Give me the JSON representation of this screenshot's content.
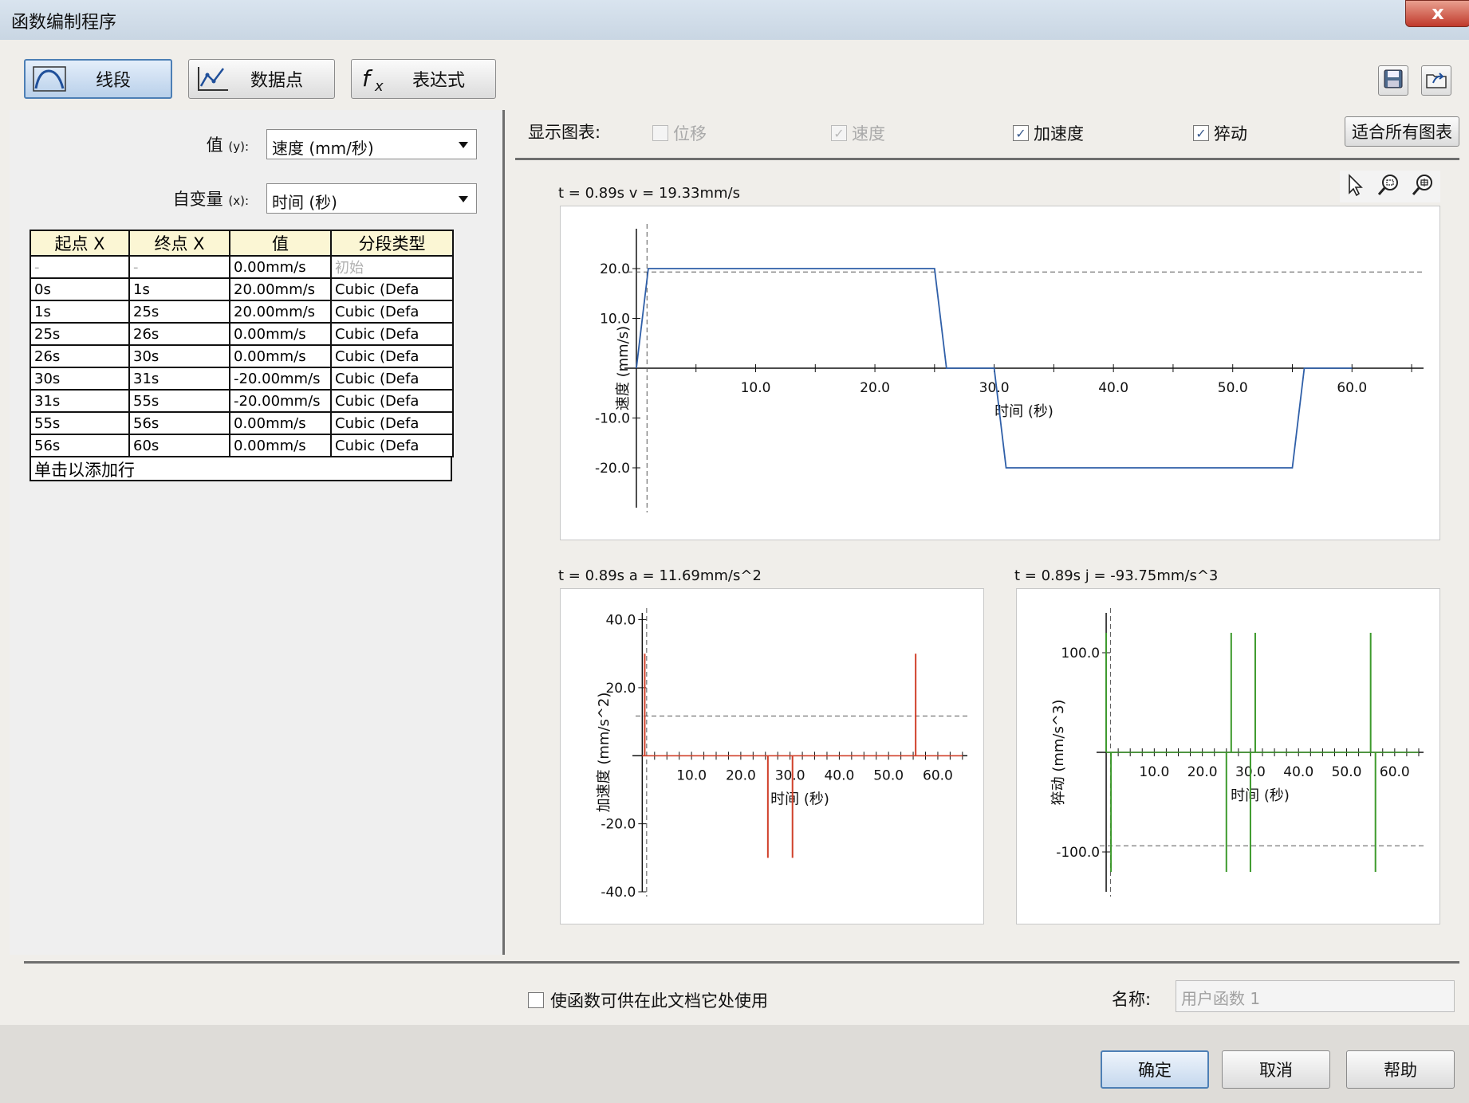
{
  "window": {
    "title": "函数编制程序",
    "close_label": "x"
  },
  "toolbar": {
    "modes": [
      {
        "label": "线段",
        "icon": "segment-curve-icon",
        "active": true
      },
      {
        "label": "数据点",
        "icon": "data-points-chart-icon",
        "active": false
      },
      {
        "label": "表达式",
        "icon": "fx-expression-icon",
        "active": false
      }
    ],
    "save_icon": "save-disk-icon",
    "import_icon": "open-folder-icon"
  },
  "form": {
    "value_label": "值",
    "value_hint": "(y):",
    "value_selected": "速度 (mm/秒)",
    "variable_label": "自变量",
    "variable_hint": "(x):",
    "variable_selected": "时间 (秒)"
  },
  "segment_table": {
    "headers": [
      "起点 X",
      "终点 X",
      "值",
      "分段类型"
    ],
    "rows": [
      [
        "-",
        "-",
        "0.00mm/s",
        "初始"
      ],
      [
        "0s",
        "1s",
        "20.00mm/s",
        "Cubic (Defa"
      ],
      [
        "1s",
        "25s",
        "20.00mm/s",
        "Cubic (Defa"
      ],
      [
        "25s",
        "26s",
        "0.00mm/s",
        "Cubic (Defa"
      ],
      [
        "26s",
        "30s",
        "0.00mm/s",
        "Cubic (Defa"
      ],
      [
        "30s",
        "31s",
        "-20.00mm/s",
        "Cubic (Defa"
      ],
      [
        "31s",
        "55s",
        "-20.00mm/s",
        "Cubic (Defa"
      ],
      [
        "55s",
        "56s",
        "0.00mm/s",
        "Cubic (Defa"
      ],
      [
        "56s",
        "60s",
        "0.00mm/s",
        "Cubic (Defa"
      ]
    ],
    "add_row_label": "单击以添加行"
  },
  "display": {
    "label": "显示图表:",
    "options": [
      {
        "label": "位移",
        "checked": false,
        "enabled": false
      },
      {
        "label": "速度",
        "checked": true,
        "enabled": false
      },
      {
        "label": "加速度",
        "checked": true,
        "enabled": true
      },
      {
        "label": "猝动",
        "checked": true,
        "enabled": true
      }
    ],
    "fit_button": "适合所有图表"
  },
  "chart_tools": [
    "pointer-arrow-icon",
    "zoom-region-icon",
    "zoom-fit-icon"
  ],
  "chart_data": [
    {
      "type": "line",
      "readout": "t = 0.89s  v = 19.33mm/s",
      "xlabel": "时间 (秒)",
      "ylabel": "速度 (mm/s)",
      "xlim": [
        -1,
        66
      ],
      "ylim": [
        -28,
        28
      ],
      "xticks": [
        10.0,
        20.0,
        30.0,
        40.0,
        50.0,
        60.0
      ],
      "xtick_labels": [
        "10.0",
        "20.0",
        "30.0",
        "40.0",
        "50.0",
        "60.0"
      ],
      "yticks": [
        20.0,
        10.0,
        -10.0,
        -20.0
      ],
      "ytick_labels": [
        "20.0",
        "10.0",
        "-10.0",
        "-20.0"
      ],
      "color": "#2f5fa8",
      "cursor_x": 0.89,
      "cursor_y": 19.33,
      "series": [
        {
          "x": [
            0,
            1,
            25,
            26,
            30,
            31,
            55,
            56,
            60
          ],
          "y": [
            0,
            20,
            20,
            0,
            0,
            -20,
            -20,
            0,
            0
          ]
        }
      ]
    },
    {
      "type": "line",
      "readout": "t = 0.89s  a = 11.69mm/s^2",
      "xlabel": "时间 (秒)",
      "ylabel": "加速度 (mm/s^2)",
      "xlim": [
        -2,
        66
      ],
      "ylim": [
        -40,
        42
      ],
      "xticks": [
        10.0,
        20.0,
        30.0,
        40.0,
        50.0,
        60.0
      ],
      "xtick_labels": [
        "10.0",
        "20.0",
        "30.0",
        "40.0",
        "50.0",
        "60.0"
      ],
      "yticks": [
        40.0,
        20.0,
        -20.0,
        -40.0
      ],
      "ytick_labels": [
        "40.0",
        "20.0",
        "-20.0",
        "-40.0"
      ],
      "color": "#d0402a",
      "cursor_x": 0.89,
      "cursor_y": 11.69,
      "spikes": [
        {
          "x": 0.5,
          "y": 30
        },
        {
          "x": 25.5,
          "y": -30
        },
        {
          "x": 30.5,
          "y": -30
        },
        {
          "x": 55.5,
          "y": 30
        }
      ]
    },
    {
      "type": "line",
      "readout": "t = 0.89s  j = -93.75mm/s^3",
      "xlabel": "时间 (秒)",
      "ylabel": "猝动 (mm/s^3)",
      "xlim": [
        -2,
        66
      ],
      "ylim": [
        -140,
        140
      ],
      "xticks": [
        10.0,
        20.0,
        30.0,
        40.0,
        50.0,
        60.0
      ],
      "xtick_labels": [
        "10.0",
        "20.0",
        "30.0",
        "40.0",
        "50.0",
        "60.0"
      ],
      "yticks": [
        100.0,
        -100.0
      ],
      "ytick_labels": [
        "100.0",
        "-100.0"
      ],
      "color": "#3d9a2c",
      "cursor_x": 0.89,
      "cursor_y": -93.75,
      "spikes": [
        {
          "x": 0,
          "y": 120
        },
        {
          "x": 1,
          "y": -120
        },
        {
          "x": 25,
          "y": -120
        },
        {
          "x": 26,
          "y": 120
        },
        {
          "x": 30,
          "y": -120
        },
        {
          "x": 31,
          "y": 120
        },
        {
          "x": 55,
          "y": 120
        },
        {
          "x": 56,
          "y": -120
        }
      ]
    }
  ],
  "footer": {
    "share_label": "使函数可供在此文档它处使用",
    "name_label": "名称:",
    "name_value": "用户函数 1",
    "ok": "确定",
    "cancel": "取消",
    "help": "帮助"
  }
}
